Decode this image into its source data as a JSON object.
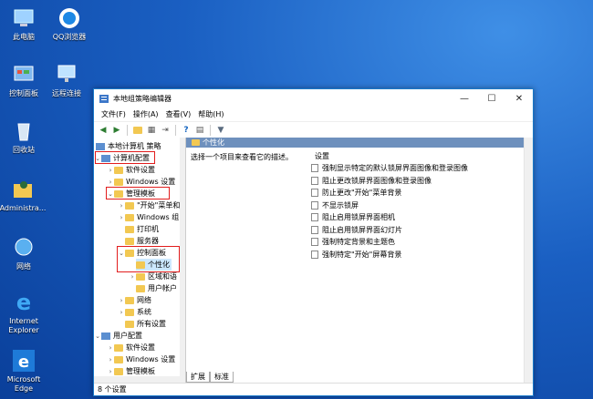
{
  "desktop": {
    "icons": [
      {
        "label": "此电脑",
        "icon": "computer-icon"
      },
      {
        "label": "QQ浏览器",
        "icon": "qq-browser-icon"
      },
      {
        "label": "控制面板",
        "icon": "control-panel-icon"
      },
      {
        "label": "远程连接",
        "icon": "remote-desktop-icon"
      },
      {
        "label": "回收站",
        "icon": "recycle-bin-icon"
      },
      {
        "label": "Administra...",
        "icon": "user-folder-icon"
      },
      {
        "label": "网络",
        "icon": "network-icon"
      },
      {
        "label": "Internet Explorer",
        "icon": "ie-icon"
      },
      {
        "label": "Microsoft Edge",
        "icon": "edge-icon"
      }
    ]
  },
  "window": {
    "title": "本地组策略编辑器",
    "controls": {
      "minimize": "—",
      "maximize": "☐",
      "close": "✕"
    },
    "menu": [
      "文件(F)",
      "操作(A)",
      "查看(V)",
      "帮助(H)"
    ],
    "tree": {
      "root": "本地计算机 策略",
      "computer_config": "计算机配置",
      "software": "软件设置",
      "windows_settings": "Windows 设置",
      "admin_templates": "管理模板",
      "start_menu": "\"开始\"菜单和",
      "windows_components": "Windows 组",
      "printers": "打印机",
      "server": "服务器",
      "control_panel": "控制面板",
      "personalization": "个性化",
      "regional": "区域和语",
      "user_accounts": "用户帐户",
      "network": "网络",
      "system": "系统",
      "all_settings": "所有设置",
      "user_config": "用户配置",
      "u_software": "软件设置",
      "u_windows_settings": "Windows 设置",
      "u_admin_templates": "管理模板"
    },
    "right_pane": {
      "header": "个性化",
      "description": "选择一个项目来查看它的描述。",
      "column_header": "设置",
      "settings": [
        "强制显示特定的默认锁屏界面图像和登录图像",
        "阻止更改锁屏界面图像和登录图像",
        "防止更改\"开始\"菜单背景",
        "不显示锁屏",
        "阻止启用锁屏界面相机",
        "阻止启用锁屏界面幻灯片",
        "强制特定背景和主题色",
        "强制特定\"开始\"屏幕背景"
      ]
    },
    "tabs": [
      "扩展",
      "标准"
    ],
    "status": "8 个设置"
  },
  "colors": {
    "highlight_box": "#e21d1d",
    "header_bar": "#6e90bd",
    "desktop": "#1a5fc2"
  }
}
